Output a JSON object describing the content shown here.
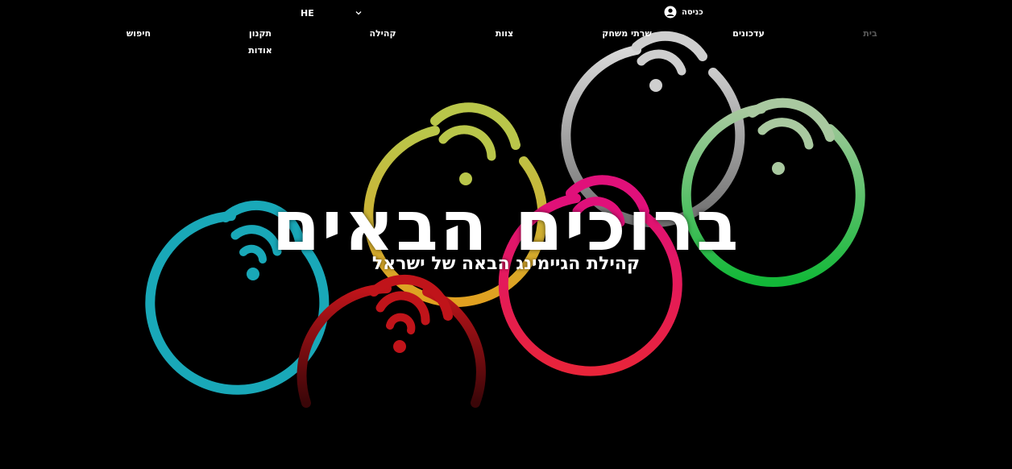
{
  "header": {
    "language": {
      "code": "HE",
      "icon": "chevron-down-icon"
    },
    "login": {
      "label": "כניסה",
      "icon": "user-avatar-icon"
    }
  },
  "nav": {
    "items": [
      {
        "label": "בית",
        "active": true
      },
      {
        "label": "עדכונים",
        "active": false
      },
      {
        "label": "שרתי משחק",
        "active": false
      },
      {
        "label": "צוות",
        "active": false
      },
      {
        "label": "קהילה",
        "active": false
      },
      {
        "label": "תקנון",
        "active": false
      },
      {
        "label": "חיפוש",
        "active": false
      },
      {
        "label": "אודות",
        "active": false
      }
    ]
  },
  "hero": {
    "title": "ברוכים הבאים",
    "subtitle": "קהילת הגיימינג הבאה של ישראל"
  },
  "colors": {
    "background": "#000000",
    "nav_active": "#5a5a5a",
    "ring_cyan": "#19a8b8",
    "ring_red": "#d0181c",
    "ring_yellow": "#d6b42a",
    "ring_magenta": "#e0107a",
    "ring_gray": "#9a9a9a",
    "ring_green": "#22c04a"
  }
}
